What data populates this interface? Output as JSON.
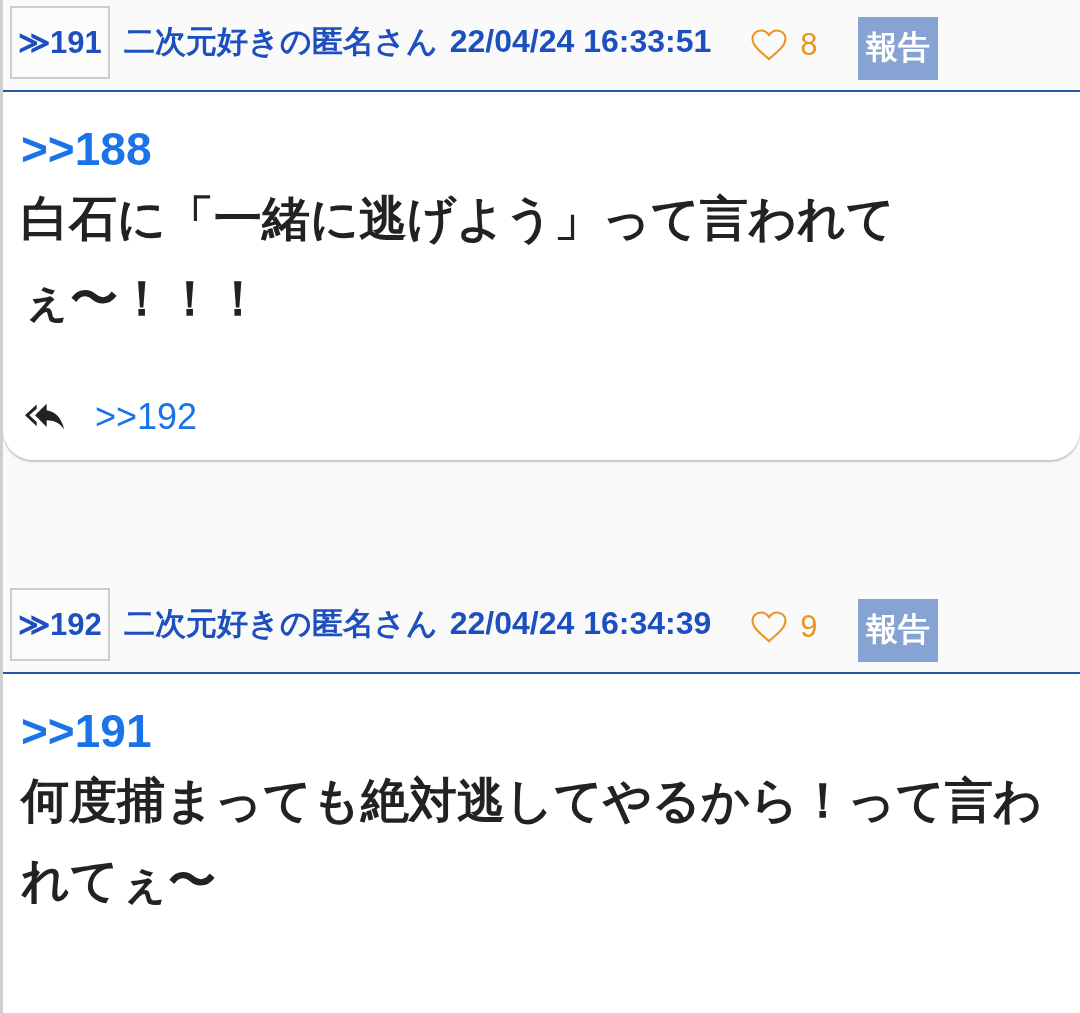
{
  "posts": [
    {
      "number": "≫191",
      "author": "二次元好きの匿名さん",
      "timestamp": "22/04/24 16:33:51",
      "liked": false,
      "likes": "8",
      "report_button": "報告",
      "anchor": ">>188",
      "body": "白石に「一緒に逃げよう」って言われてぇ〜！！！",
      "replies": [
        ">>192"
      ]
    },
    {
      "number": "≫192",
      "author": "二次元好きの匿名さん",
      "timestamp": "22/04/24 16:34:39",
      "liked": false,
      "likes": "9",
      "report_button": "報告",
      "anchor": ">>191",
      "body": "何度捕まっても絶対逃してやるから！って言われてぇ〜"
    }
  ]
}
